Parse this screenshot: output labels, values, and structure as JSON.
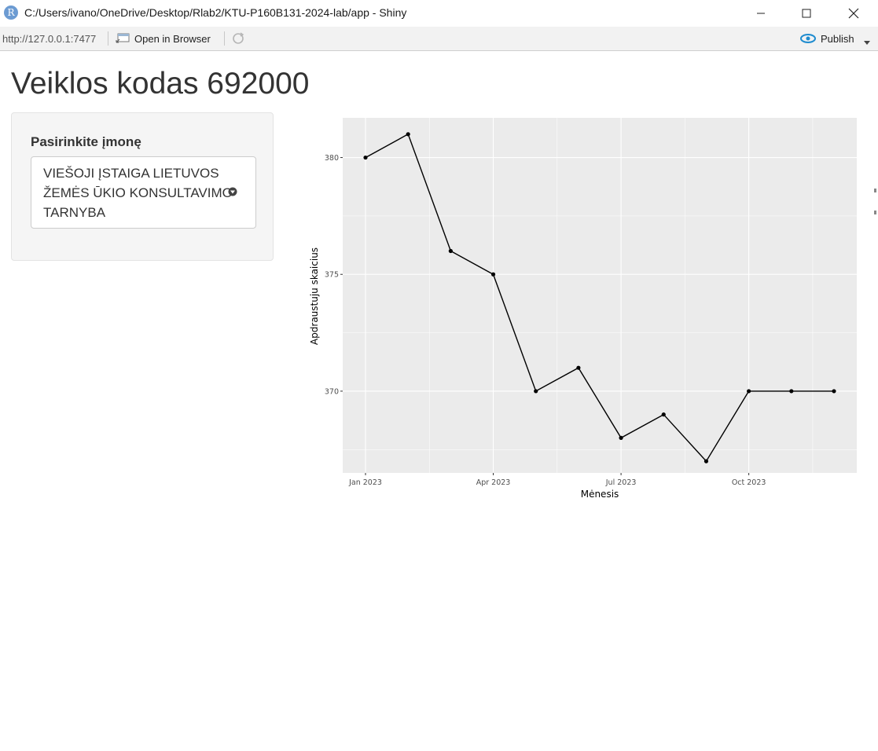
{
  "window": {
    "title": "C:/Users/ivano/OneDrive/Desktop/Rlab2/KTU-P160B131-2024-lab/app - Shiny",
    "app_icon_letter": "R"
  },
  "toolbar": {
    "url": "http://127.0.0.1:7477",
    "open_in_browser_label": "Open in Browser",
    "publish_label": "Publish"
  },
  "page": {
    "title": "Veiklos kodas 692000"
  },
  "sidebar": {
    "select_label": "Pasirinkite įmonę",
    "selected_value": "VIEŠOJI ĮSTAIGA LIETUVOS ŽEMĖS ŪKIO KONSULTAVIMO TARNYBA"
  },
  "colors": {
    "panel_bg": "#ebebeb",
    "grid": "#ffffff",
    "line": "#000000",
    "accent_publish": "#1f8ccf"
  },
  "chart_data": {
    "type": "line",
    "title": "",
    "xlabel": "Mėnesis",
    "ylabel": "Apdraustuju skaicius",
    "x": [
      "2023-01",
      "2023-02",
      "2023-03",
      "2023-04",
      "2023-05",
      "2023-06",
      "2023-07",
      "2023-08",
      "2023-09",
      "2023-10",
      "2023-11",
      "2023-12"
    ],
    "values": [
      380,
      381,
      376,
      375,
      370,
      371,
      368,
      369,
      367,
      370,
      370,
      370
    ],
    "x_ticks": [
      "Jan 2023",
      "Apr 2023",
      "Jul 2023",
      "Oct 2023"
    ],
    "y_ticks": [
      370,
      375,
      380
    ],
    "ylim": [
      366.5,
      381.7
    ],
    "grid": true,
    "markers": true
  }
}
